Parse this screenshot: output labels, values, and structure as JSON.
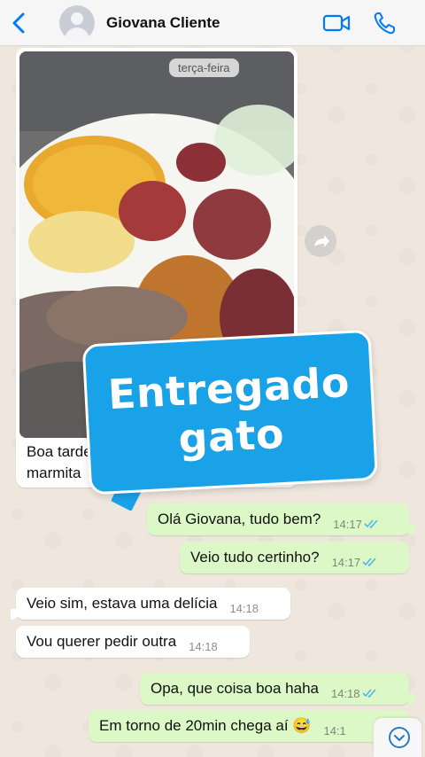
{
  "header": {
    "contact_name": "Giovana Cliente",
    "back_icon": "chevron-left-icon",
    "video_icon": "video-camera-icon",
    "call_icon": "phone-icon",
    "accent": "#007aff"
  },
  "image_message": {
    "day_label": "terça-feira",
    "caption_line1": "Boa tarde",
    "caption_line2": "marmita",
    "forward_icon": "forward-arrow-icon"
  },
  "sticker": {
    "line1": "Entregado",
    "line2": "gato",
    "color": "#1aa2e8"
  },
  "messages": [
    {
      "dir": "out",
      "text": "Olá Giovana, tudo bem?",
      "time": "14:17"
    },
    {
      "dir": "out",
      "text": "Veio tudo certinho?",
      "time": "14:17"
    },
    {
      "dir": "in",
      "text": "Veio sim, estava uma delícia",
      "time": "14:18"
    },
    {
      "dir": "in",
      "text": "Vou querer pedir outra",
      "time": "14:18"
    },
    {
      "dir": "out",
      "text": "Opa, que coisa boa haha",
      "time": "14:18"
    },
    {
      "dir": "out",
      "text": "Em torno de 20min chega aí 😅",
      "time": "14:1"
    }
  ],
  "colors": {
    "outgoing_bubble": "#dcf8c6",
    "incoming_bubble": "#ffffff",
    "read_ticks": "#4fb6ec"
  }
}
